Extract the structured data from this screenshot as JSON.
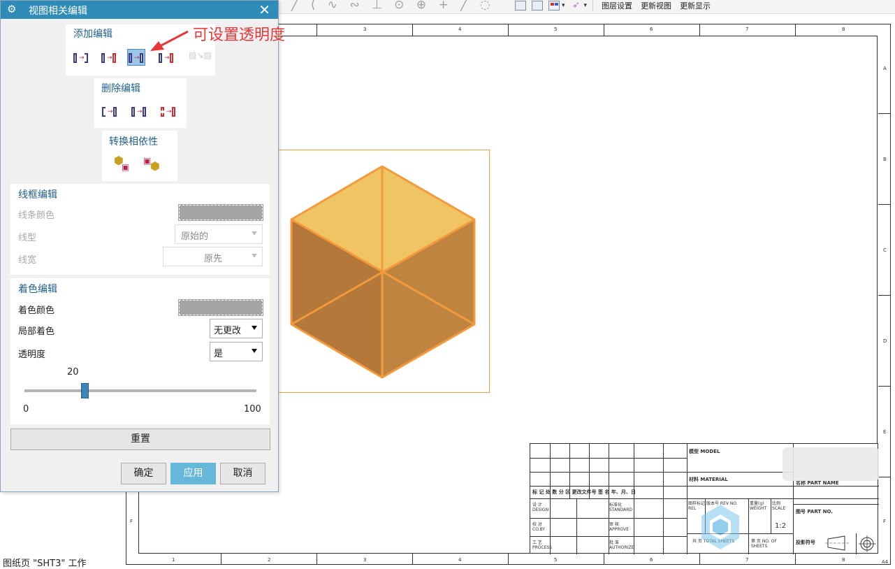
{
  "dialog": {
    "title": "视图相关编辑",
    "close_glyph": "✕",
    "gear_glyph": "⚙",
    "add_edit": {
      "title": "添加编辑"
    },
    "delete_edit": {
      "title": "删除编辑"
    },
    "convert": {
      "title": "转换相依性"
    },
    "wireframe": {
      "title": "线框编辑",
      "line_color_label": "线条颜色",
      "line_type_label": "线型",
      "line_type_value": "原始的",
      "line_width_label": "线宽",
      "line_width_value": "原先"
    },
    "shading": {
      "title": "着色编辑",
      "shade_color_label": "着色颜色",
      "partial_shade_label": "局部着色",
      "partial_shade_value": "无更改",
      "transparency_label": "透明度",
      "transparency_value": "是",
      "slider_value": "20",
      "slider_value_fraction": 0.2,
      "slider_min": "0",
      "slider_max": "100"
    },
    "reset_label": "重置",
    "ok_label": "确定",
    "apply_label": "应用",
    "cancel_label": "取消"
  },
  "annotation": {
    "text": "可设置透明度",
    "color": "#e63838"
  },
  "toolbar": {
    "layer_settings": "图层设置",
    "update_view": "更新视图",
    "update_display": "更新显示"
  },
  "sheet": {
    "top_zones": [
      "3",
      "4",
      "5",
      "6",
      "7",
      "8"
    ],
    "bottom_zones": [
      "1",
      "2",
      "3",
      "4",
      "5",
      "6",
      "7",
      "8"
    ],
    "right_zones": [
      "A",
      "B",
      "C",
      "D",
      "E",
      "F"
    ],
    "left_zones": [
      "F"
    ],
    "size_label": "A4"
  },
  "title_block": {
    "model_label": "模型 MODEL",
    "material_label": "材料 MATERIAL",
    "part_name_label": "名称 PART NAME",
    "part_no_label": "图号 PART NO.",
    "revision_header": "标 记 处 数 分 区 更改文件号 签 名 年、月、日",
    "design": "设 计 DESIGN",
    "checked": "校 对 CO.BY",
    "process": "工 艺 PROCESS",
    "standard": "标准化 STANDARD",
    "approve": "审 核 APPROVE",
    "authorize": "批 准 AUTHORIZE",
    "stage_header": "图样标记 REL",
    "rev_no": "版本号 REV NO.",
    "weight": "重量(g) WEIGHT",
    "scale_header": "比例 SCALE",
    "scale_value": "1:2",
    "total_sheets": "共 页 TOTAL SHEETS",
    "sheet_no": "第 页 NO. OF SHEETS",
    "projection_label": "投影符号"
  },
  "status": {
    "text": "图纸页 \"SHT3\" 工作"
  },
  "colors": {
    "titlebar": "#2f8bb8",
    "cube_edge": "#f39a3d",
    "cube_top": "#f0c060",
    "apply_button": "#65b8d9"
  }
}
